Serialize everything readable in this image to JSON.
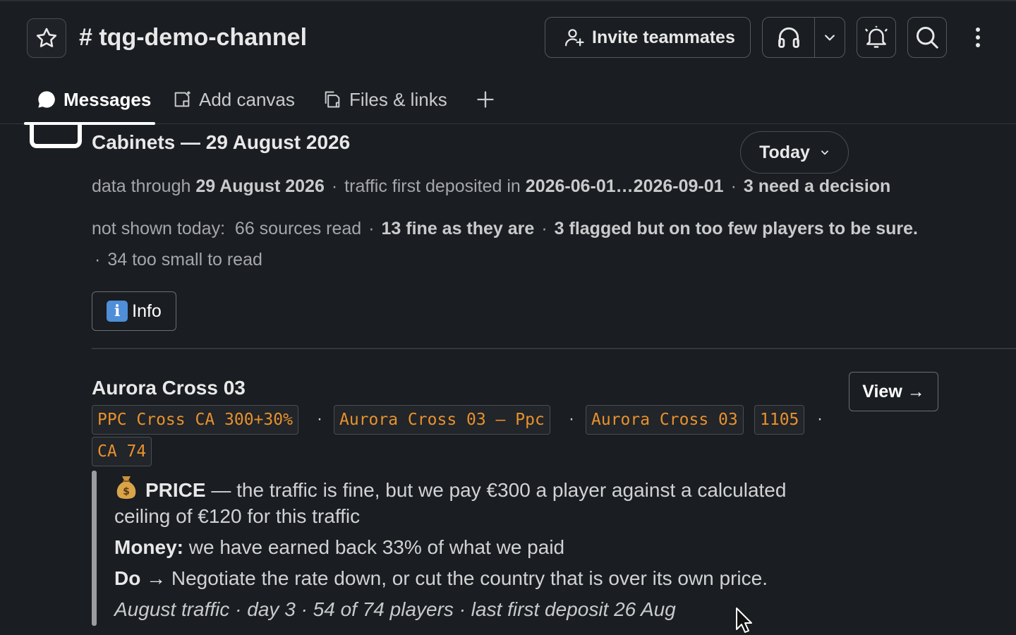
{
  "header": {
    "channel_name": "# tqg-demo-channel",
    "invite_label": "Invite teammates"
  },
  "tabs": [
    {
      "label": "Messages",
      "active": true
    },
    {
      "label": "Add canvas",
      "active": false
    },
    {
      "label": "Files & links",
      "active": false
    }
  ],
  "message": {
    "title": "Cabinets — 29 August 2026",
    "today_label": "Today",
    "meta1": {
      "prefix": "data through",
      "date": "29 August 2026",
      "traffic_prefix": "traffic first deposited in",
      "range": "2026-06-01…2026-09-01",
      "decision": "3 need a decision"
    },
    "meta2": {
      "prefix": "not shown today:",
      "read": "66 sources read",
      "fine": "13 fine as they are",
      "flagged": "3 flagged but on too few players to be sure.",
      "small": "34 too small to read"
    },
    "info_label": "Info"
  },
  "source": {
    "name": "Aurora Cross 03",
    "view_label": "View →",
    "tags": [
      "PPC Cross CA 300+30%",
      "Aurora Cross 03 – Ppc",
      "Aurora Cross 03",
      "1105",
      "CA 74"
    ],
    "price_label": "PRICE",
    "price_text": "— the traffic is fine, but we pay €300 a player against a calculated",
    "price_text2": "ceiling of €120 for this traffic",
    "money_label": "Money:",
    "money_text": "we have earned back 33% of what we paid",
    "do_label": "Do →",
    "do_text": "Negotiate the rate down, or cut the country that is over its own price.",
    "footer": "August traffic · day 3 · 54 of 74 players · last first deposit 26 Aug"
  }
}
